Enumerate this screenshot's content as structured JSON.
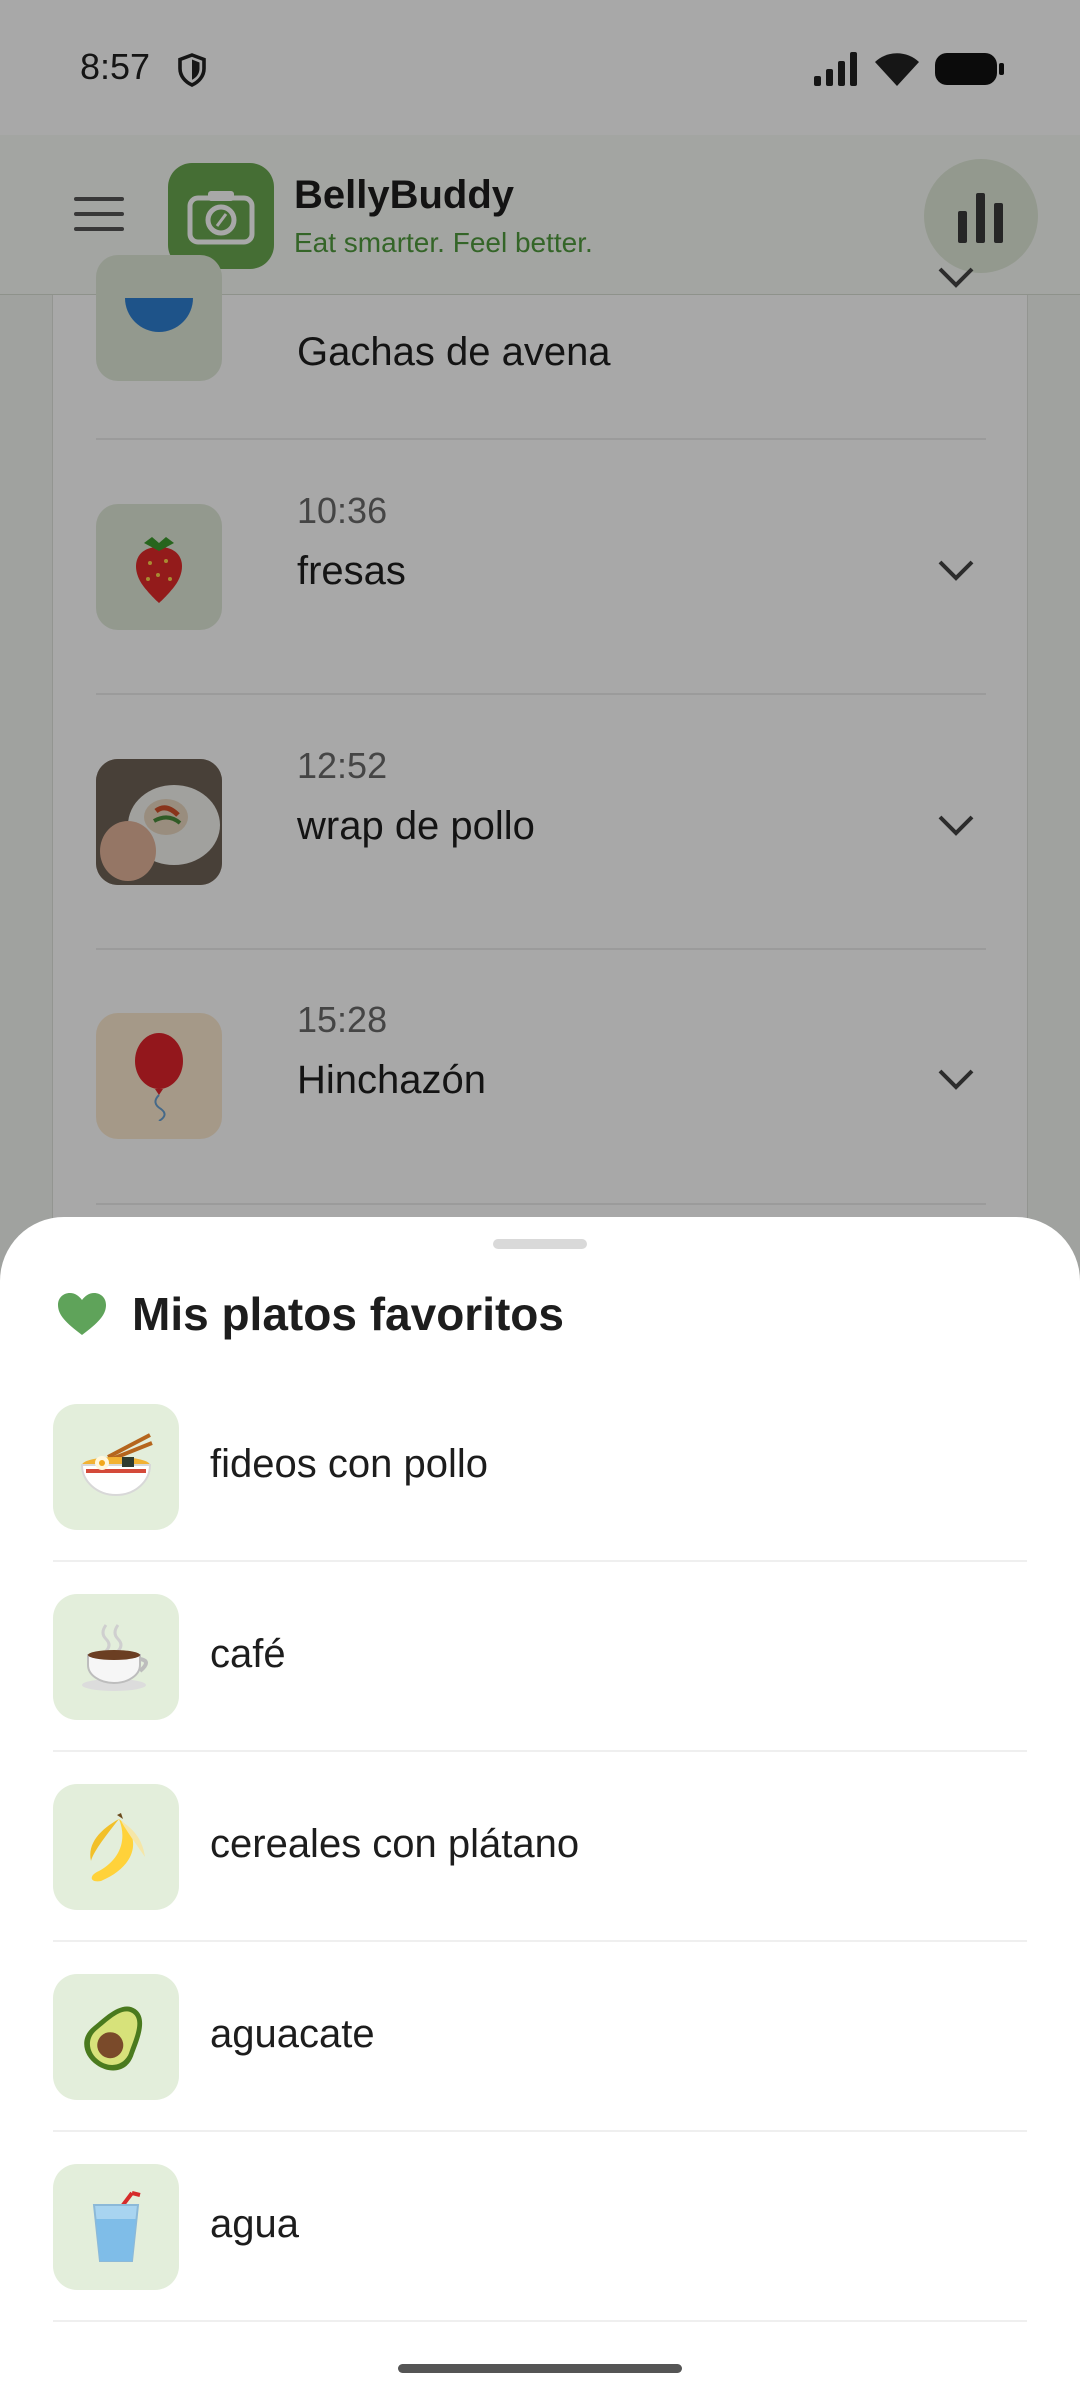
{
  "status_bar": {
    "time": "8:57"
  },
  "app_bar": {
    "title": "BellyBuddy",
    "subtitle": "Eat smarter. Feel better.",
    "menu_icon": "hamburger-menu-icon",
    "stats_icon": "bar-chart-icon"
  },
  "timeline": {
    "entries": [
      {
        "time": "",
        "name": "Gachas de avena",
        "icon": "bowl-icon"
      },
      {
        "time": "10:36",
        "name": "fresas",
        "icon": "strawberry-icon"
      },
      {
        "time": "12:52",
        "name": "wrap de pollo",
        "icon": "photo-thumbnail"
      },
      {
        "time": "15:28",
        "name": "Hinchazón",
        "icon": "balloon-icon"
      }
    ]
  },
  "favorites_sheet": {
    "title": "Mis platos favoritos",
    "items": [
      {
        "name": "fideos con pollo",
        "icon": "noodle-bowl-icon"
      },
      {
        "name": "café",
        "icon": "coffee-cup-icon"
      },
      {
        "name": "cereales con plátano",
        "icon": "banana-icon"
      },
      {
        "name": "aguacate",
        "icon": "avocado-icon"
      },
      {
        "name": "agua",
        "icon": "water-glass-icon"
      }
    ]
  },
  "colors": {
    "accent": "#6aa84f",
    "accent_light": "#e3eedb",
    "subtitle_green": "#4f9a3d"
  }
}
